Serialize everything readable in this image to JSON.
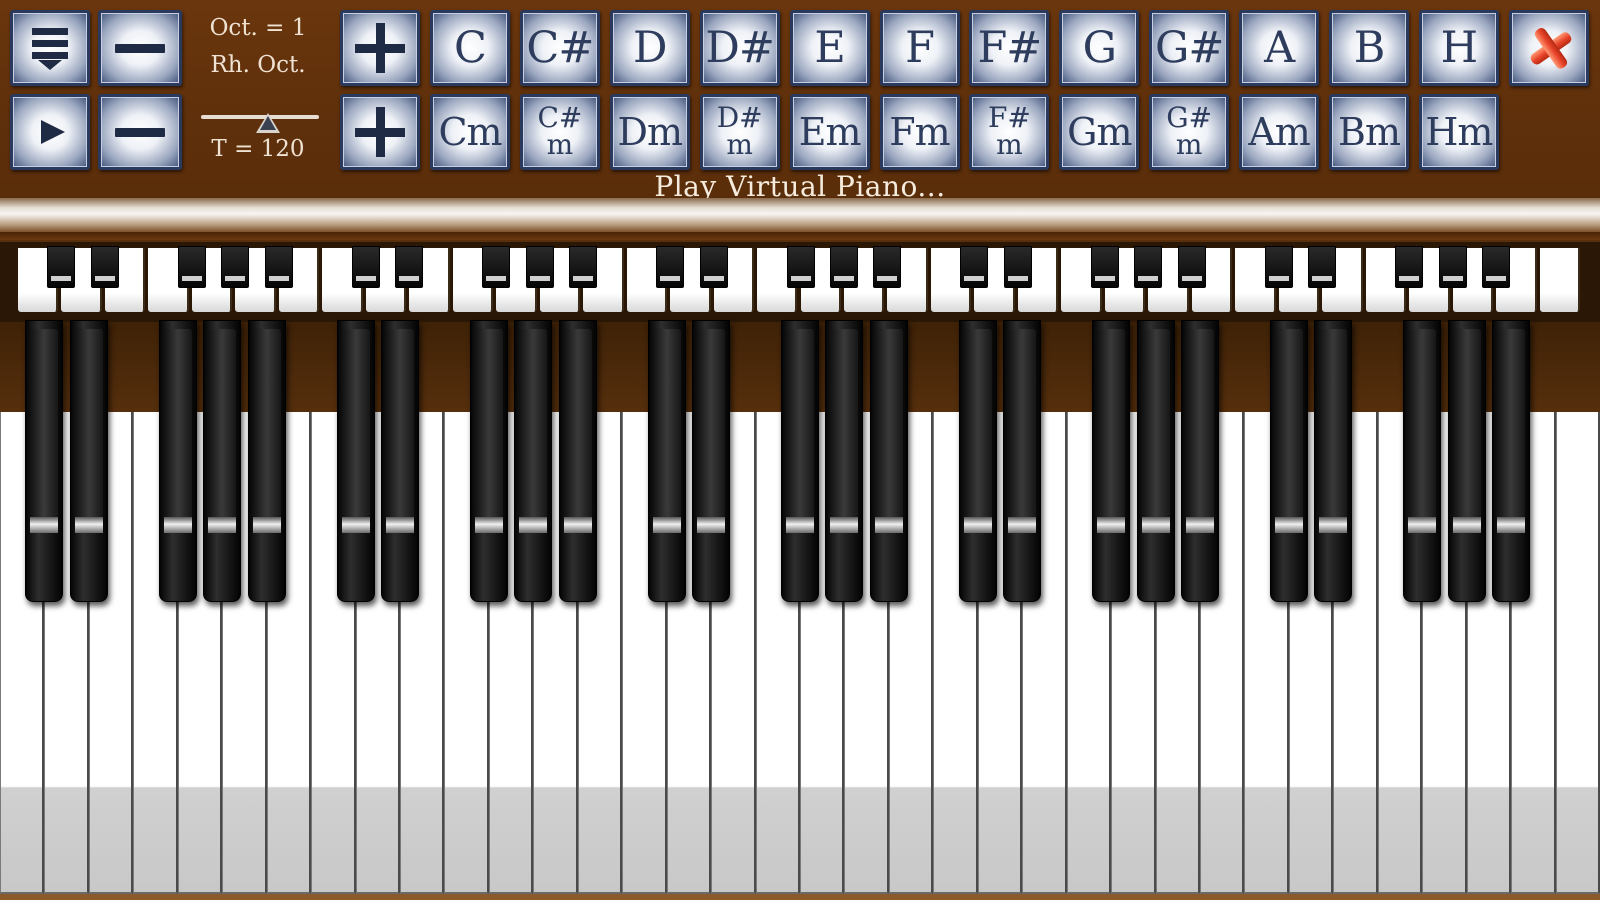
{
  "toolbar": {
    "octave_text": "Oct. = 1",
    "rh_octave_text": "Rh. Oct.",
    "tempo_text": "T = 120",
    "tempo_value": 120,
    "notes": [
      "C",
      "C#",
      "D",
      "D#",
      "E",
      "F",
      "F#",
      "G",
      "G#",
      "A",
      "B",
      "H"
    ],
    "minors": [
      "Cm",
      "C#\nm",
      "Dm",
      "D#\nm",
      "Em",
      "Fm",
      "F#\nm",
      "Gm",
      "G#\nm",
      "Am",
      "Bm",
      "Hm"
    ],
    "icons": {
      "menu": "menu-icon",
      "play": "play-icon",
      "minus": "minus-icon",
      "plus": "plus-icon",
      "close": "close-icon"
    },
    "accent_color": "#2e3d5e",
    "close_color": "#e8442a"
  },
  "status": {
    "text": "Play Virtual Piano..."
  },
  "piano": {
    "white_key_count": 36,
    "minimap_white_key_count": 36
  }
}
